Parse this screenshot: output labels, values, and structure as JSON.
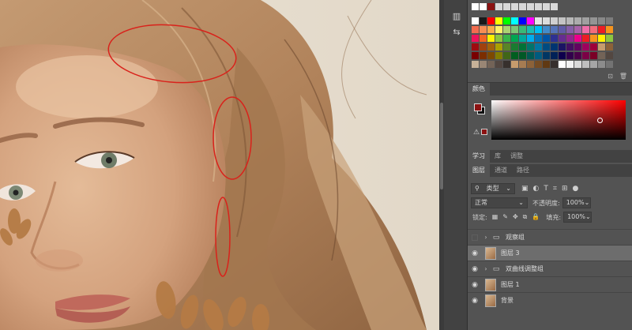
{
  "swatch_rows": [
    [
      "#ffffff",
      "#1a1a1a",
      "#ff0000",
      "#ffff00",
      "#00ff00",
      "#00ffff",
      "#0000ff",
      "#ff00ff",
      "#e5e5e5",
      "#dcdcdc",
      "#d0d0d0",
      "#c4c4c4",
      "#b8b8b8",
      "#acacac",
      "#a0a0a0",
      "#949494",
      "#888888",
      "#7c7c7c"
    ],
    [
      "#f26c4f",
      "#f68e55",
      "#fbad4a",
      "#fff467",
      "#acd372",
      "#7cc576",
      "#3bb878",
      "#1abbb4",
      "#00bff3",
      "#438ccb",
      "#5574b9",
      "#605ca8",
      "#855fa8",
      "#a763a8",
      "#f06ea9",
      "#f26d7d",
      "#ed1c24",
      "#f7941d"
    ],
    [
      "#ed145b",
      "#f26522",
      "#fff200",
      "#8dc63f",
      "#39b54a",
      "#00a651",
      "#00a99d",
      "#00aeef",
      "#0072bc",
      "#0054a6",
      "#2e3192",
      "#662d91",
      "#92278f",
      "#ec008c",
      "#ed1c24",
      "#f7941d",
      "#fff200",
      "#8dc63f"
    ],
    [
      "#9e0b0f",
      "#a0410d",
      "#a36209",
      "#aba000",
      "#598527",
      "#1a7b30",
      "#007236",
      "#00746b",
      "#0076a3",
      "#004b80",
      "#003471",
      "#1b1464",
      "#440e62",
      "#630460",
      "#9e005d",
      "#9e0039",
      "#c69c6d",
      "#8c6239"
    ],
    [
      "#790000",
      "#7b2e00",
      "#7d4900",
      "#827b00",
      "#406618",
      "#005e20",
      "#005826",
      "#005952",
      "#005b7f",
      "#003663",
      "#002157",
      "#0d004c",
      "#32004b",
      "#4b0049",
      "#7b0046",
      "#7a0026",
      "#736357",
      "#534741"
    ],
    [
      "#c7b299",
      "#998675",
      "#736357",
      "#534741",
      "#37302d",
      "#c69c6d",
      "#a67c52",
      "#8c6239",
      "#754c24",
      "#603913",
      "#362f2d",
      "#ffffff",
      "#f2f2f2",
      "#d9d9d9",
      "#bfbfbf",
      "#a6a6a6",
      "#8c8c8c",
      "#737373"
    ]
  ],
  "color_panel": {
    "tab": "颜色"
  },
  "top_tabs": [
    "学习",
    "库",
    "调整"
  ],
  "sub_tabs": [
    "图层",
    "通道",
    "路径"
  ],
  "filter": {
    "kind_label": "类型"
  },
  "blend": {
    "mode": "正常",
    "opacity_label": "不透明度:",
    "opacity_value": "100%"
  },
  "lock": {
    "label": "锁定:",
    "fill_label": "填充:",
    "fill_value": "100%"
  },
  "layers": [
    {
      "name": "观察组",
      "type": "group",
      "visible": false,
      "selected": false
    },
    {
      "name": "图层 3",
      "type": "pixel",
      "visible": true,
      "selected": true
    },
    {
      "name": "双曲线调整组",
      "type": "group",
      "visible": true,
      "selected": false
    },
    {
      "name": "图层 1",
      "type": "pixel",
      "visible": true,
      "selected": false
    },
    {
      "name": "背景",
      "type": "pixel",
      "visible": true,
      "selected": false
    }
  ]
}
